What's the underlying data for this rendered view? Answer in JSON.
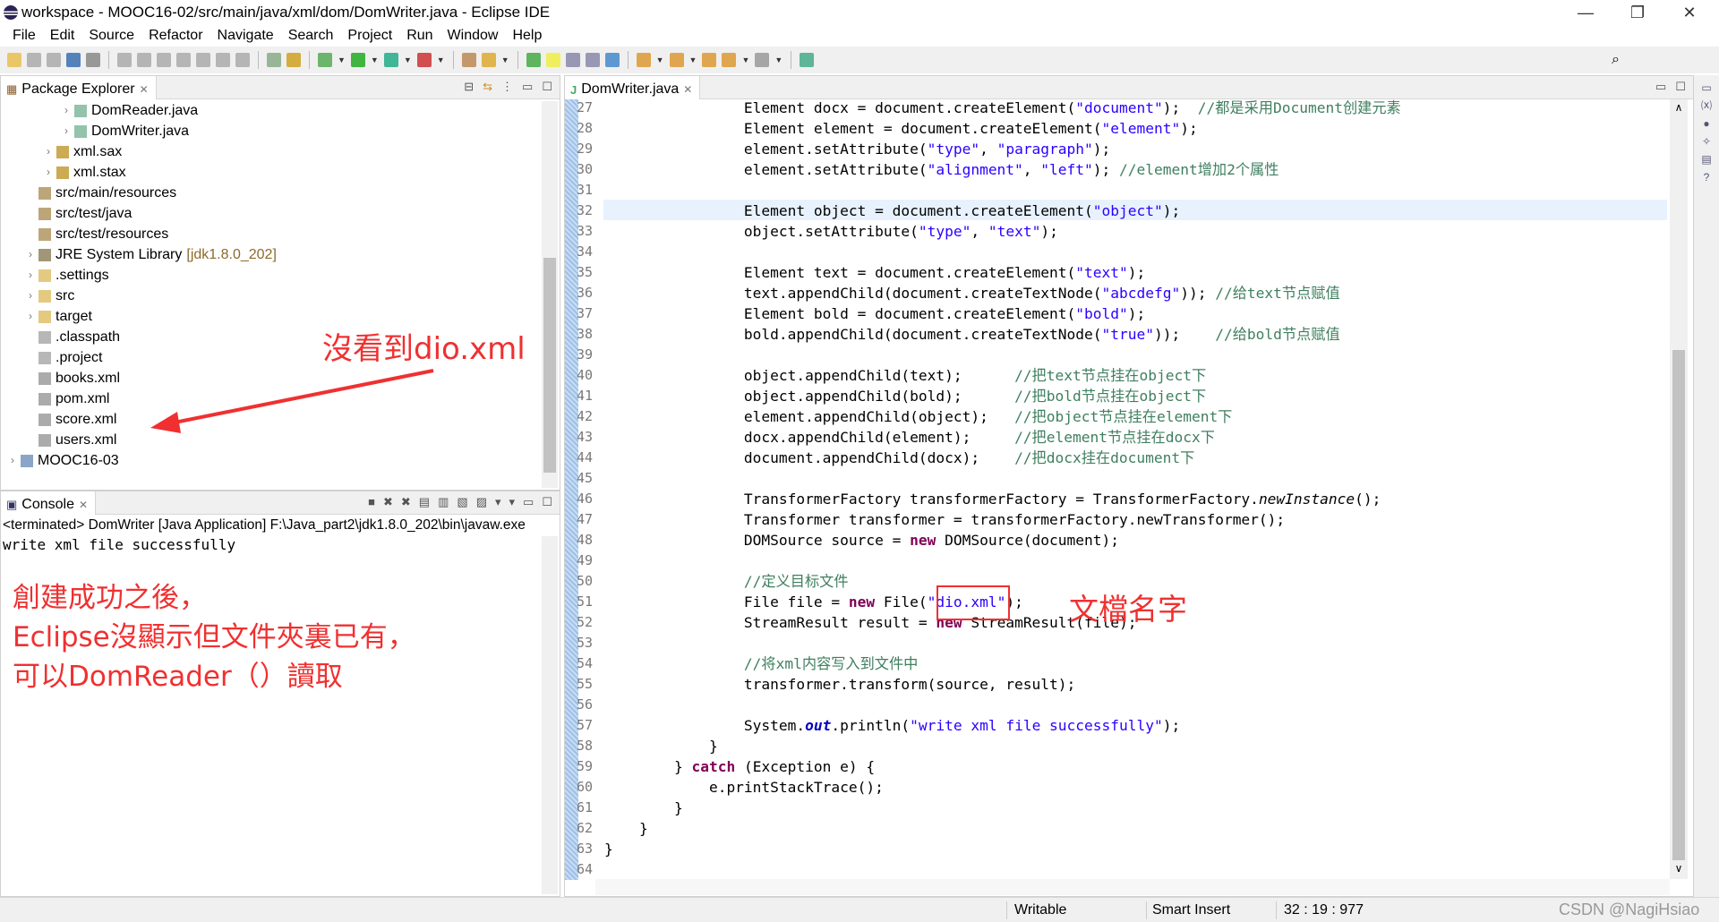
{
  "window": {
    "title": "workspace - MOOC16-02/src/main/java/xml/dom/DomWriter.java - Eclipse IDE",
    "controls": [
      "—",
      "❐",
      "✕"
    ]
  },
  "menu": [
    "File",
    "Edit",
    "Source",
    "Refactor",
    "Navigate",
    "Search",
    "Project",
    "Run",
    "Window",
    "Help"
  ],
  "package_explorer": {
    "title": "Package Explorer",
    "items": [
      {
        "label": "DomReader.java",
        "level": 3,
        "chevron": true,
        "icon": "java-file-icon"
      },
      {
        "label": "DomWriter.java",
        "level": 3,
        "chevron": true,
        "icon": "java-file-icon"
      },
      {
        "label": "xml.sax",
        "level": 2,
        "chevron": true,
        "icon": "package-icon"
      },
      {
        "label": "xml.stax",
        "level": 2,
        "chevron": true,
        "icon": "package-icon"
      },
      {
        "label": "src/main/resources",
        "level": 1,
        "chevron": false,
        "icon": "source-folder-icon"
      },
      {
        "label": "src/test/java",
        "level": 1,
        "chevron": false,
        "icon": "source-folder-icon"
      },
      {
        "label": "src/test/resources",
        "level": 1,
        "chevron": false,
        "icon": "source-folder-icon"
      },
      {
        "label": "JRE System Library",
        "decoration": "[jdk1.8.0_202]",
        "level": 1,
        "chevron": true,
        "icon": "library-icon"
      },
      {
        "label": ".settings",
        "level": 1,
        "chevron": true,
        "icon": "folder-icon"
      },
      {
        "label": "src",
        "level": 1,
        "chevron": true,
        "icon": "folder-icon"
      },
      {
        "label": "target",
        "level": 1,
        "chevron": true,
        "icon": "folder-icon"
      },
      {
        "label": ".classpath",
        "level": 1,
        "chevron": false,
        "icon": "file-icon"
      },
      {
        "label": ".project",
        "level": 1,
        "chevron": false,
        "icon": "file-icon"
      },
      {
        "label": "books.xml",
        "level": 1,
        "chevron": false,
        "icon": "xml-file-icon"
      },
      {
        "label": "pom.xml",
        "level": 1,
        "chevron": false,
        "icon": "xml-file-icon"
      },
      {
        "label": "score.xml",
        "level": 1,
        "chevron": false,
        "icon": "xml-file-icon"
      },
      {
        "label": "users.xml",
        "level": 1,
        "chevron": false,
        "icon": "xml-file-icon"
      },
      {
        "label": "MOOC16-03",
        "level": 0,
        "chevron": true,
        "icon": "project-icon"
      }
    ]
  },
  "console": {
    "title": "Console",
    "terminated": "<terminated> DomWriter [Java Application] F:\\Java_part2\\jdk1.8.0_202\\bin\\javaw.exe",
    "output": "write xml file successfully"
  },
  "editor": {
    "tab": "DomWriter.java",
    "current_line": 32,
    "lines": [
      {
        "n": 27,
        "t": [
          [
            "p",
            "                Element docx = document.createElement("
          ],
          [
            "s",
            "\"document\""
          ],
          [
            "p",
            ");  "
          ],
          [
            "c",
            "//都是采用Document创建元素"
          ]
        ]
      },
      {
        "n": 28,
        "t": [
          [
            "p",
            "                Element element = document.createElement("
          ],
          [
            "s",
            "\"element\""
          ],
          [
            "p",
            ");"
          ]
        ]
      },
      {
        "n": 29,
        "t": [
          [
            "p",
            "                element.setAttribute("
          ],
          [
            "s",
            "\"type\""
          ],
          [
            "p",
            ", "
          ],
          [
            "s",
            "\"paragraph\""
          ],
          [
            "p",
            ");"
          ]
        ]
      },
      {
        "n": 30,
        "t": [
          [
            "p",
            "                element.setAttribute("
          ],
          [
            "s",
            "\"alignment\""
          ],
          [
            "p",
            ", "
          ],
          [
            "s",
            "\"left\""
          ],
          [
            "p",
            "); "
          ],
          [
            "c",
            "//element增加2个属性"
          ]
        ]
      },
      {
        "n": 31,
        "t": []
      },
      {
        "n": 32,
        "t": [
          [
            "p",
            "                Element object = document.createElement("
          ],
          [
            "s",
            "\"object\""
          ],
          [
            "p",
            ");"
          ]
        ]
      },
      {
        "n": 33,
        "t": [
          [
            "p",
            "                object.setAttribute("
          ],
          [
            "s",
            "\"type\""
          ],
          [
            "p",
            ", "
          ],
          [
            "s",
            "\"text\""
          ],
          [
            "p",
            ");"
          ]
        ]
      },
      {
        "n": 34,
        "t": []
      },
      {
        "n": 35,
        "t": [
          [
            "p",
            "                Element text = document.createElement("
          ],
          [
            "s",
            "\"text\""
          ],
          [
            "p",
            ");"
          ]
        ]
      },
      {
        "n": 36,
        "t": [
          [
            "p",
            "                text.appendChild(document.createTextNode("
          ],
          [
            "s",
            "\"abcdefg\""
          ],
          [
            "p",
            ")); "
          ],
          [
            "c",
            "//给text节点赋值"
          ]
        ]
      },
      {
        "n": 37,
        "t": [
          [
            "p",
            "                Element bold = document.createElement("
          ],
          [
            "s",
            "\"bold\""
          ],
          [
            "p",
            ");"
          ]
        ]
      },
      {
        "n": 38,
        "t": [
          [
            "p",
            "                bold.appendChild(document.createTextNode("
          ],
          [
            "s",
            "\"true\""
          ],
          [
            "p",
            "));    "
          ],
          [
            "c",
            "//给bold节点赋值"
          ]
        ]
      },
      {
        "n": 39,
        "t": []
      },
      {
        "n": 40,
        "t": [
          [
            "p",
            "                object.appendChild(text);      "
          ],
          [
            "c",
            "//把text节点挂在object下"
          ]
        ]
      },
      {
        "n": 41,
        "t": [
          [
            "p",
            "                object.appendChild(bold);      "
          ],
          [
            "c",
            "//把bold节点挂在object下"
          ]
        ]
      },
      {
        "n": 42,
        "t": [
          [
            "p",
            "                element.appendChild(object);   "
          ],
          [
            "c",
            "//把object节点挂在element下"
          ]
        ]
      },
      {
        "n": 43,
        "t": [
          [
            "p",
            "                docx.appendChild(element);     "
          ],
          [
            "c",
            "//把element节点挂在docx下"
          ]
        ]
      },
      {
        "n": 44,
        "t": [
          [
            "p",
            "                document.appendChild(docx);    "
          ],
          [
            "c",
            "//把docx挂在document下"
          ]
        ]
      },
      {
        "n": 45,
        "t": []
      },
      {
        "n": 46,
        "t": [
          [
            "p",
            "                TransformerFactory transformerFactory = TransformerFactory."
          ],
          [
            "i",
            "newInstance"
          ],
          [
            "p",
            "();"
          ]
        ]
      },
      {
        "n": 47,
        "t": [
          [
            "p",
            "                Transformer transformer = transformerFactory.newTransformer();"
          ]
        ]
      },
      {
        "n": 48,
        "t": [
          [
            "p",
            "                DOMSource source = "
          ],
          [
            "k",
            "new"
          ],
          [
            "p",
            " DOMSource(document);"
          ]
        ]
      },
      {
        "n": 49,
        "t": []
      },
      {
        "n": 50,
        "t": [
          [
            "c",
            "                //定义目标文件"
          ]
        ]
      },
      {
        "n": 51,
        "t": [
          [
            "p",
            "                File file = "
          ],
          [
            "k",
            "new"
          ],
          [
            "p",
            " File("
          ],
          [
            "s",
            "\"dio.xml\""
          ],
          [
            "p",
            ");"
          ]
        ]
      },
      {
        "n": 52,
        "t": [
          [
            "p",
            "                StreamResult result = "
          ],
          [
            "k",
            "new"
          ],
          [
            "p",
            " StreamResult(file);"
          ]
        ]
      },
      {
        "n": 53,
        "t": []
      },
      {
        "n": 54,
        "t": [
          [
            "c",
            "                //将xml内容写入到文件中"
          ]
        ]
      },
      {
        "n": 55,
        "t": [
          [
            "p",
            "                transformer.transform(source, result);"
          ]
        ]
      },
      {
        "n": 56,
        "t": []
      },
      {
        "n": 57,
        "t": [
          [
            "p",
            "                System."
          ],
          [
            "f",
            "out"
          ],
          [
            "p",
            ".println("
          ],
          [
            "s",
            "\"write xml file successfully\""
          ],
          [
            "p",
            ");"
          ]
        ]
      },
      {
        "n": 58,
        "t": [
          [
            "p",
            "            }"
          ]
        ]
      },
      {
        "n": 59,
        "t": [
          [
            "p",
            "        } "
          ],
          [
            "k",
            "catch"
          ],
          [
            "p",
            " (Exception e) {"
          ]
        ]
      },
      {
        "n": 60,
        "t": [
          [
            "p",
            "            e.printStackTrace();"
          ]
        ]
      },
      {
        "n": 61,
        "t": [
          [
            "p",
            "        }"
          ]
        ]
      },
      {
        "n": 62,
        "t": [
          [
            "p",
            "    }"
          ]
        ]
      },
      {
        "n": 63,
        "t": [
          [
            "p",
            "}"
          ]
        ]
      },
      {
        "n": 64,
        "t": []
      }
    ]
  },
  "annotations": {
    "missing": "沒看到dio.xml",
    "console_note": [
      "創建成功之後，",
      "Eclipse沒顯示但文件夾裏已有，",
      "可以DomReader（）讀取"
    ],
    "filename_note": "文檔名字",
    "color": "#f03030"
  },
  "status": {
    "writable": "Writable",
    "insert_mode": "Smart Insert",
    "position": "32 : 19 : 977"
  },
  "watermark": "CSDN @NagiHsiao",
  "colors": {
    "keyword": "#7f0055",
    "string": "#2a00ff",
    "comment": "#3f7f5f",
    "current_line": "#e8f2fe"
  }
}
